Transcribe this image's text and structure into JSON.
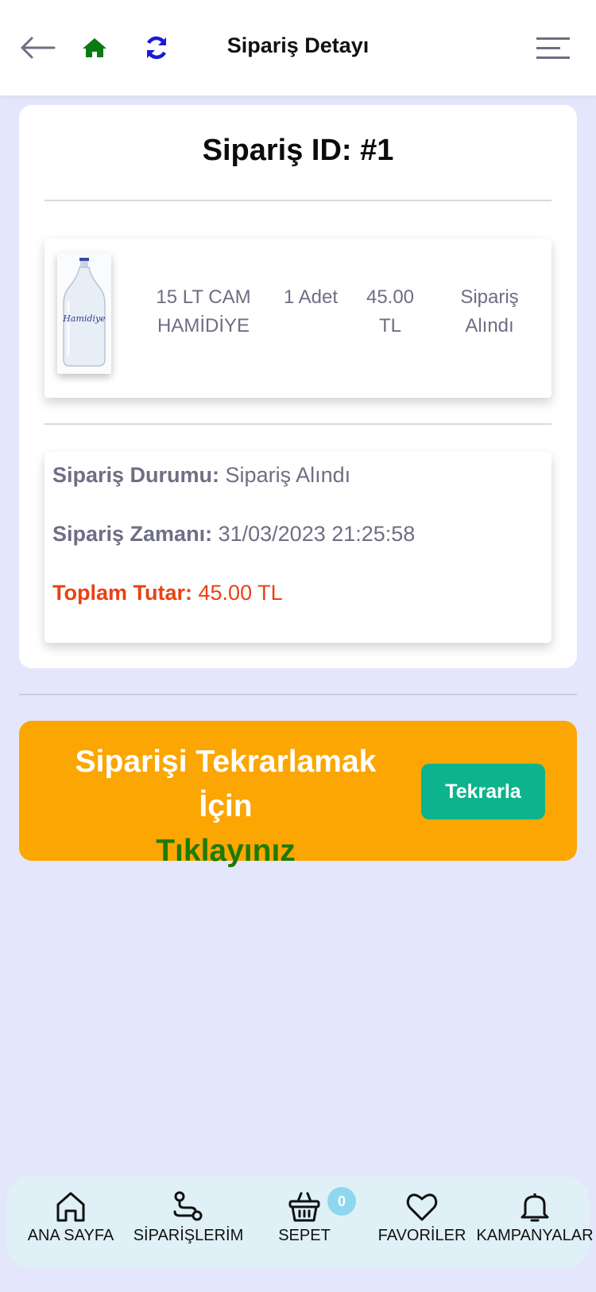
{
  "header": {
    "title": "Sipariş Detayı",
    "icons": {
      "back": "arrow-left-icon",
      "home": "home-icon",
      "refresh": "refresh-icon",
      "menu": "menu-icon"
    },
    "colors": {
      "home": "#0a7a12",
      "refresh": "#1a1ad6",
      "menu": "#6e6e84"
    }
  },
  "order": {
    "title": "Sipariş ID: #1",
    "item": {
      "image_label": "Hamidiye",
      "name": "15 LT CAM HAMİDİYE",
      "quantity": "1 Adet",
      "price": "45.00 TL",
      "status": "Sipariş Alındı"
    },
    "details": {
      "status_label": "Sipariş Durumu:",
      "status_value": "Sipariş Alındı",
      "time_label": "Sipariş Zamanı:",
      "time_value": "31/03/2023 21:25:58",
      "total_label": "Toplam Tutar:",
      "total_value": "45.00 TL"
    }
  },
  "repeat": {
    "text_line1": "Siparişi Tekrarlamak İçin",
    "text_line2": "Tıklayınız",
    "button_label": "Tekrarla",
    "colors": {
      "banner": "#fba602",
      "button": "#0db38d",
      "highlight": "#1e7a08"
    }
  },
  "nav": {
    "items": [
      {
        "label": "ANA SAYFA",
        "icon": "home-outline-icon"
      },
      {
        "label": "SİPARİŞLERİM",
        "icon": "route-icon"
      },
      {
        "label": "SEPET",
        "icon": "basket-icon"
      },
      {
        "label": "FAVORİLER",
        "icon": "heart-icon"
      },
      {
        "label": "KAMPANYALAR",
        "icon": "bell-icon"
      }
    ],
    "cart_count": "0"
  }
}
